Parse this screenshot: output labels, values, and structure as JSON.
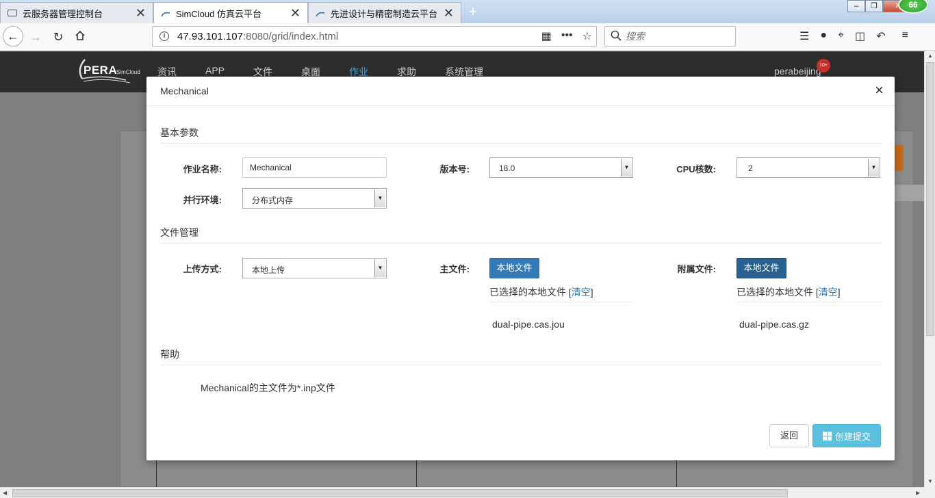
{
  "browser": {
    "tabs": [
      {
        "title": "云服务器管理控制台",
        "active": false
      },
      {
        "title": "SimCloud 仿真云平台",
        "active": true
      },
      {
        "title": "先进设计与精密制造云平台",
        "active": false
      }
    ],
    "close_glyph": "✕",
    "new_tab_glyph": "+",
    "win_min": "–",
    "win_max": "❐",
    "win_close": "✕",
    "notification_count": "66",
    "url_host": "47.93.101.107",
    "url_rest": ":8080/grid/index.html",
    "search_placeholder": "搜索"
  },
  "app": {
    "logo_text": "PERA",
    "logo_sub": "SimCloud",
    "menu": [
      "资讯",
      "APP",
      "文件",
      "桌面",
      "作业",
      "求助",
      "系统管理"
    ],
    "active_menu": "作业",
    "user": "perabeijing",
    "user_badge": "10+"
  },
  "modal": {
    "title": "Mechanical",
    "close_glyph": "×",
    "sections": {
      "basic": "基本参数",
      "files": "文件管理",
      "help": "帮助"
    },
    "labels": {
      "job_name": "作业名称:",
      "version": "版本号:",
      "cpu": "CPU核数:",
      "parallel": "并行环境:",
      "upload_method": "上传方式:",
      "main_file": "主文件:",
      "attach_file": "附属文件:"
    },
    "values": {
      "job_name": "Mechanical",
      "version": "18.0",
      "cpu": "2",
      "parallel": "分布式内存",
      "upload_method": "本地上传"
    },
    "local_file_button": "本地文件",
    "selected_prefix": "已选择的本地文件 [",
    "clear_link": "清空",
    "selected_suffix": "]",
    "main_file_name": "dual-pipe.cas.jou",
    "attach_file_name": "dual-pipe.cas.gz",
    "help_text": "Mechanical的主文件为*.inp文件",
    "back_button": "返回",
    "submit_button": "创建提交"
  }
}
